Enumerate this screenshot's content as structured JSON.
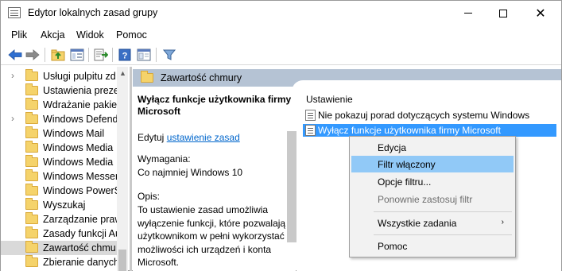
{
  "window": {
    "title": "Edytor lokalnych zasad grupy"
  },
  "menu": [
    "Plik",
    "Akcja",
    "Widok",
    "Pomoc"
  ],
  "toolbar": {
    "buttons": [
      "back-arrow-icon",
      "forward-arrow-icon",
      "up-folder-icon",
      "show-hide-tree-icon",
      "export-list-icon",
      "help-icon",
      "properties-icon",
      "filter-icon"
    ]
  },
  "tree": {
    "items": [
      {
        "label": "Usługi pulpitu zd",
        "expandable": true
      },
      {
        "label": "Ustawienia preze",
        "expandable": false
      },
      {
        "label": "Wdrażanie pakiet",
        "expandable": false
      },
      {
        "label": "Windows Defend",
        "expandable": true
      },
      {
        "label": "Windows Mail",
        "expandable": false
      },
      {
        "label": "Windows Media",
        "expandable": false
      },
      {
        "label": "Windows Media",
        "expandable": false
      },
      {
        "label": "Windows Messer",
        "expandable": false
      },
      {
        "label": "Windows PowerS",
        "expandable": false
      },
      {
        "label": "Wyszukaj",
        "expandable": false
      },
      {
        "label": "Zarządzanie praw",
        "expandable": false
      },
      {
        "label": "Zasady funkcji Au",
        "expandable": false
      },
      {
        "label": "Zawartość chmu",
        "expandable": false,
        "selected": true
      },
      {
        "label": "Zbieranie danych",
        "expandable": false
      }
    ]
  },
  "right": {
    "header": "Zawartość chmury",
    "description": {
      "title": "Wyłącz funkcje użytkownika firmy Microsoft",
      "edit_prefix": "Edytuj ",
      "edit_link": "ustawienie zasad ",
      "requirements_label": "Wymagania:",
      "requirements_value": "Co najmniej Windows 10",
      "opis_label": "Opis:",
      "opis_text": "To ustawienie zasad umożliwia wyłączenie funkcji, które pozwalają użytkownikom w pełni wykorzystać możliwości ich urządzeń i konta Microsoft."
    },
    "settings": {
      "column_header": "Ustawienie",
      "rows": [
        {
          "label": "Nie pokazuj porad dotyczących systemu Windows"
        },
        {
          "label": "Wyłącz funkcje użytkownika firmy Microsoft",
          "selected": true
        }
      ]
    }
  },
  "context_menu": {
    "items": [
      {
        "label": "Edycja"
      },
      {
        "label": "Filtr włączony",
        "hover": true
      },
      {
        "label": "Opcje filtru..."
      },
      {
        "label": "Ponownie zastosuj filtr",
        "disabled": true
      },
      {
        "label": "Wszystkie zadania",
        "submenu": true
      },
      {
        "label": "Pomoc"
      }
    ]
  },
  "colors": {
    "header_bg": "#b5c3d4",
    "selected_row": "#3399ff",
    "menu_hover": "#91c9f7",
    "link": "#0066cc"
  }
}
